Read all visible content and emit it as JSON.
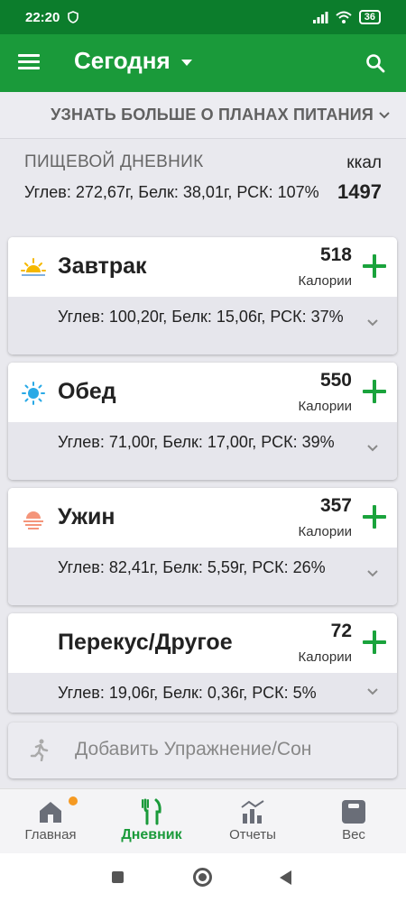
{
  "status_bar": {
    "time": "22:20",
    "battery": "36"
  },
  "app_bar": {
    "title": "Сегодня"
  },
  "plans_link": {
    "label": "УЗНАТЬ БОЛЬШЕ О ПЛАНАХ ПИТАНИЯ"
  },
  "summary": {
    "label": "ПИЩЕВОЙ ДНЕВНИК",
    "unit": "ккал",
    "macros": "Углев: 272,67г, Белк: 38,01г, РСК: 107%",
    "total": "1497"
  },
  "calories_label": "Калории",
  "meals": [
    {
      "name": "Завтрак",
      "calories": "518",
      "macros": "Углев: 100,20г, Белк: 15,06г, РСК: 37%",
      "icon": "sunrise-icon"
    },
    {
      "name": "Обед",
      "calories": "550",
      "macros": "Углев: 71,00г, Белк: 17,00г, РСК: 39%",
      "icon": "sun-icon"
    },
    {
      "name": "Ужин",
      "calories": "357",
      "macros": "Углев: 82,41г, Белк: 5,59г, РСК: 26%",
      "icon": "sunset-icon"
    },
    {
      "name": "Перекус/Другое",
      "calories": "72",
      "macros": "Углев: 19,06г, Белк: 0,36г, РСК: 5%",
      "icon": "moon-icon"
    }
  ],
  "exercise": {
    "label": "Добавить Упражнение/Сон"
  },
  "bottom_nav": [
    {
      "label": "Главная",
      "icon": "home-icon"
    },
    {
      "label": "Дневник",
      "icon": "cutlery-icon",
      "active": true
    },
    {
      "label": "Отчеты",
      "icon": "reports-icon"
    },
    {
      "label": "Вес",
      "icon": "scale-icon"
    }
  ],
  "colors": {
    "primary": "#1a9a3a",
    "status_bar": "#0c7d2c",
    "add": "#1aa33c",
    "badge": "#f59a23"
  }
}
